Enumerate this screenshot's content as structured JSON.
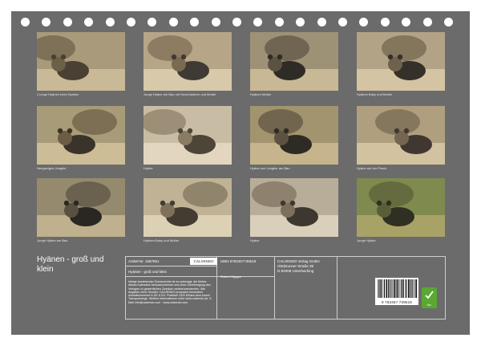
{
  "calendar": {
    "title": "Hyänen - groß und klein",
    "photos": [
      {
        "caption": "2 junge Hyänen beim Spielen",
        "icon": "photo-hyena-pups-playing"
      },
      {
        "caption": "Junge Hyäne am Bau mit Geschwistern und Mutter",
        "icon": "photo-hyena-den-family"
      },
      {
        "caption": "Hyänen Mutter",
        "icon": "photo-hyena-mother"
      },
      {
        "caption": "Hyänen Baby und Mutter",
        "icon": "photo-hyena-baby-mother"
      },
      {
        "caption": "Neugieriges Jungtier",
        "icon": "photo-curious-cub"
      },
      {
        "caption": "Hyäne",
        "icon": "photo-hyena-portrait"
      },
      {
        "caption": "Hyäne und Jungtier am Bau",
        "icon": "photo-hyena-cub-den"
      },
      {
        "caption": "Hyäne auf der Pirsch",
        "icon": "photo-hyena-prowling"
      },
      {
        "caption": "Junge Hyäne am Bau",
        "icon": "photo-young-hyena-den"
      },
      {
        "caption": "Hyänen Baby und Mutter",
        "icon": "photo-baby-and-mother"
      },
      {
        "caption": "Hyäne",
        "icon": "photo-hyena-profile"
      },
      {
        "caption": "Junge Hyäne",
        "icon": "photo-young-hyena"
      }
    ]
  },
  "info_panel": {
    "article_label": "Artikel-Nr. 1687851",
    "brand_badge": "CALVENDO",
    "isbn": "ISBN 9783457739518",
    "subtitle": "Hyänen - groß und klein",
    "author": "Robert Styppa",
    "legal_text": "Infolge bestehender Schutzrechte ist es untersagt, die Motive dieses Kalenders herauszunehmen und ohne Genehmigung des Verlages zu gewerblichen Zwecken weiterzuverwenden. Alle Angaben ohne Gewähr. CALVENDO produziert besonders umweltschonend in DE & EU. Postfach 2322 84/aus dem kurzer Transportwege. Weitere Informationen unter www.calvendo.de. E-Mail: info@calvendo.com · www.calvendo.com",
    "publisher_name": "CALVENDO Verlag GmbH",
    "publisher_street": "Ottobrunner Straße 39",
    "publisher_city": "D-82008 Unterhaching",
    "barcode_digits": "9 783457 739518",
    "fsc_label": "fsc"
  },
  "colors": {
    "sheet": "#6b6b6b",
    "fsc_green": "#5aa832"
  }
}
